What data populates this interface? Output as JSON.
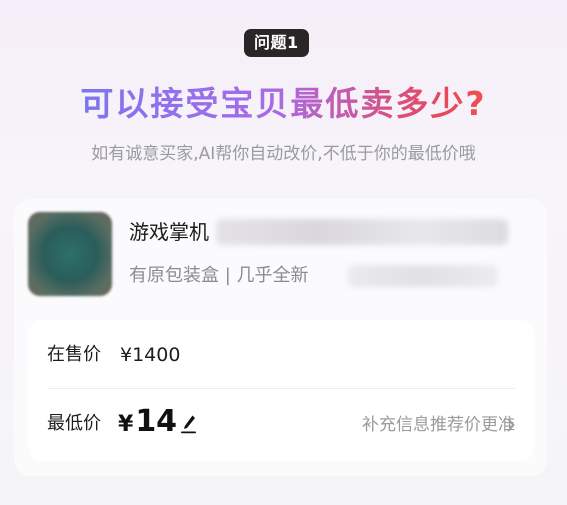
{
  "header": {
    "badge": "问题1",
    "headline": "可以接受宝贝最低卖多少?",
    "subtitle": "如有诚意买家,AI帮你自动改价,不低于你的最低价哦"
  },
  "product": {
    "title": "游戏掌机",
    "subtitle": "有原包装盒 | 几乎全新"
  },
  "pricing": {
    "selling_label": "在售价",
    "selling_value": "¥1400",
    "min_label": "最低价",
    "min_currency": "¥",
    "min_value": "14",
    "recommend_text": "补充信息推荐价更准"
  },
  "icons": {
    "edit": "pencil-edit-icon",
    "chevron": "chevron-right-icon"
  },
  "colors": {
    "headline_gradient": [
      "#6a79f2",
      "#a86be8",
      "#e8475a",
      "#ff5d45"
    ],
    "badge_bg": "#2a2628"
  }
}
